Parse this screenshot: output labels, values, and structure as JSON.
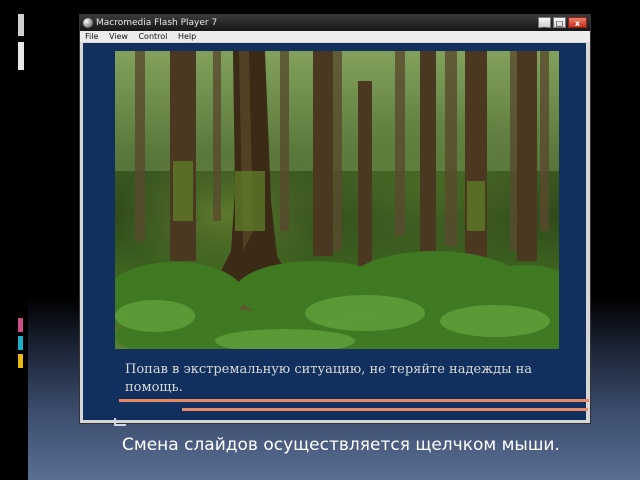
{
  "window": {
    "title": "Macromedia Flash Player 7",
    "controls": {
      "minimize": "_",
      "maximize": "□",
      "close": "x"
    }
  },
  "menu": {
    "items": [
      {
        "label": "File"
      },
      {
        "label": "View"
      },
      {
        "label": "Control"
      },
      {
        "label": "Help"
      }
    ]
  },
  "content": {
    "caption": "Попав в экстремальную ситуацию, не теряйте надежды на помощь."
  },
  "slide": {
    "note": "Смена слайдов осуществляется щелчком мыши."
  },
  "icons": {
    "app": "flash-player-icon"
  },
  "colors": {
    "content_bg": "#12305e",
    "rule": "#e58966",
    "close_button": "#c9321e"
  }
}
